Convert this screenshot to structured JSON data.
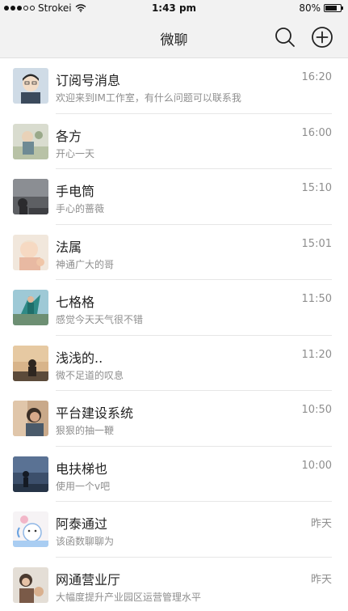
{
  "status_bar": {
    "carrier": "Strokei",
    "time": "1:43 pm",
    "battery": "80%",
    "battery_level": 0.8
  },
  "nav": {
    "title": "微聊",
    "search_icon": "search-icon",
    "add_icon": "add-circle-icon"
  },
  "conversations": [
    {
      "title": "订阅号消息",
      "subtitle": "欢迎来到IM工作室，有什么问题可以联系我",
      "time": "16:20"
    },
    {
      "title": "各方",
      "subtitle": "开心一天",
      "time": "16:00"
    },
    {
      "title": "手电筒",
      "subtitle": "手心的蔷薇",
      "time": "15:10"
    },
    {
      "title": "法属",
      "subtitle": "神通广大的哥",
      "time": "15:01"
    },
    {
      "title": "七格格",
      "subtitle": "感觉今天天气很不错",
      "time": "11:50"
    },
    {
      "title": "浅浅的..",
      "subtitle": "微不足道的叹息",
      "time": "11:20"
    },
    {
      "title": "平台建设系统",
      "subtitle": "狠狠的抽一鞭",
      "time": "10:50"
    },
    {
      "title": "电扶梯也",
      "subtitle": "使用一个v吧",
      "time": "10:00"
    },
    {
      "title": "阿泰通过",
      "subtitle": "该函数聊聊为",
      "time": "昨天"
    },
    {
      "title": "网通营业厅",
      "subtitle": "大幅度提升产业园区运营管理水平",
      "time": "昨天"
    }
  ]
}
